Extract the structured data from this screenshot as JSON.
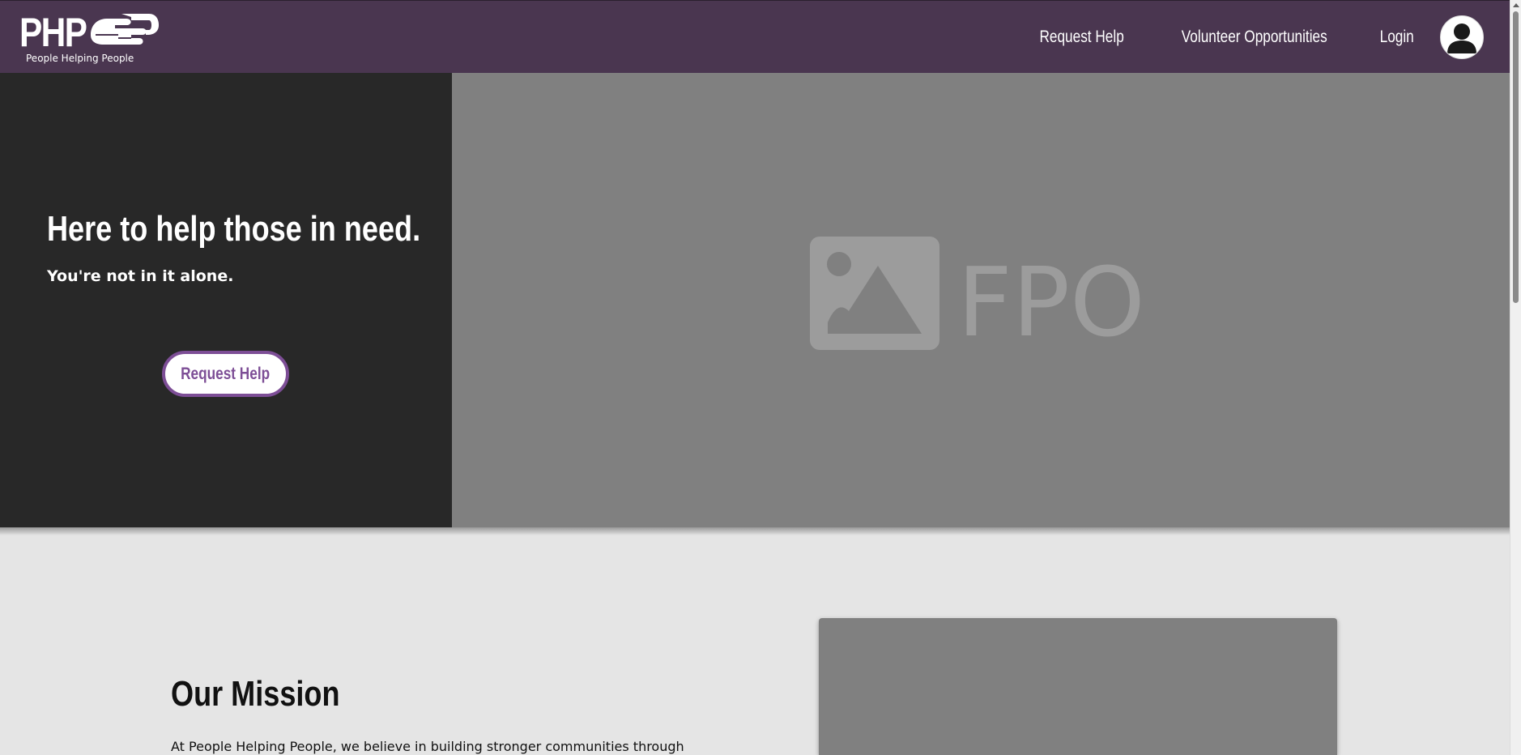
{
  "header": {
    "logo_text": "PHP",
    "logo_tagline": "People Helping People",
    "nav": [
      "Request Help",
      "Volunteer Opportunities",
      "Login"
    ]
  },
  "hero": {
    "title": "Here to help those in need.",
    "subtitle": "You're not in it alone.",
    "button_label": "Request Help",
    "placeholder_text": "FPO"
  },
  "mission": {
    "title": "Our Mission",
    "text": "At People Helping People, we believe in building stronger communities through"
  },
  "colors": {
    "header_bg": "#4a3650",
    "hero_left_bg": "#282828",
    "placeholder_bg": "#808080",
    "accent": "#7d4e96",
    "page_bg": "#e5e5e5"
  },
  "icons": [
    "handshake-icon",
    "user-avatar-icon",
    "image-placeholder-icon"
  ]
}
